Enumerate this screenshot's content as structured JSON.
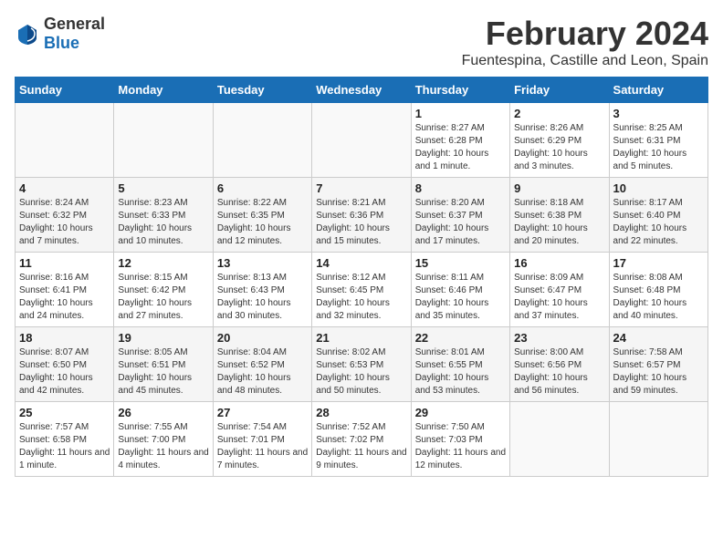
{
  "logo": {
    "general": "General",
    "blue": "Blue"
  },
  "title": "February 2024",
  "subtitle": "Fuentespina, Castille and Leon, Spain",
  "days_of_week": [
    "Sunday",
    "Monday",
    "Tuesday",
    "Wednesday",
    "Thursday",
    "Friday",
    "Saturday"
  ],
  "weeks": [
    [
      {
        "day": "",
        "detail": ""
      },
      {
        "day": "",
        "detail": ""
      },
      {
        "day": "",
        "detail": ""
      },
      {
        "day": "",
        "detail": ""
      },
      {
        "day": "1",
        "detail": "Sunrise: 8:27 AM\nSunset: 6:28 PM\nDaylight: 10 hours and 1 minute."
      },
      {
        "day": "2",
        "detail": "Sunrise: 8:26 AM\nSunset: 6:29 PM\nDaylight: 10 hours and 3 minutes."
      },
      {
        "day": "3",
        "detail": "Sunrise: 8:25 AM\nSunset: 6:31 PM\nDaylight: 10 hours and 5 minutes."
      }
    ],
    [
      {
        "day": "4",
        "detail": "Sunrise: 8:24 AM\nSunset: 6:32 PM\nDaylight: 10 hours and 7 minutes."
      },
      {
        "day": "5",
        "detail": "Sunrise: 8:23 AM\nSunset: 6:33 PM\nDaylight: 10 hours and 10 minutes."
      },
      {
        "day": "6",
        "detail": "Sunrise: 8:22 AM\nSunset: 6:35 PM\nDaylight: 10 hours and 12 minutes."
      },
      {
        "day": "7",
        "detail": "Sunrise: 8:21 AM\nSunset: 6:36 PM\nDaylight: 10 hours and 15 minutes."
      },
      {
        "day": "8",
        "detail": "Sunrise: 8:20 AM\nSunset: 6:37 PM\nDaylight: 10 hours and 17 minutes."
      },
      {
        "day": "9",
        "detail": "Sunrise: 8:18 AM\nSunset: 6:38 PM\nDaylight: 10 hours and 20 minutes."
      },
      {
        "day": "10",
        "detail": "Sunrise: 8:17 AM\nSunset: 6:40 PM\nDaylight: 10 hours and 22 minutes."
      }
    ],
    [
      {
        "day": "11",
        "detail": "Sunrise: 8:16 AM\nSunset: 6:41 PM\nDaylight: 10 hours and 24 minutes."
      },
      {
        "day": "12",
        "detail": "Sunrise: 8:15 AM\nSunset: 6:42 PM\nDaylight: 10 hours and 27 minutes."
      },
      {
        "day": "13",
        "detail": "Sunrise: 8:13 AM\nSunset: 6:43 PM\nDaylight: 10 hours and 30 minutes."
      },
      {
        "day": "14",
        "detail": "Sunrise: 8:12 AM\nSunset: 6:45 PM\nDaylight: 10 hours and 32 minutes."
      },
      {
        "day": "15",
        "detail": "Sunrise: 8:11 AM\nSunset: 6:46 PM\nDaylight: 10 hours and 35 minutes."
      },
      {
        "day": "16",
        "detail": "Sunrise: 8:09 AM\nSunset: 6:47 PM\nDaylight: 10 hours and 37 minutes."
      },
      {
        "day": "17",
        "detail": "Sunrise: 8:08 AM\nSunset: 6:48 PM\nDaylight: 10 hours and 40 minutes."
      }
    ],
    [
      {
        "day": "18",
        "detail": "Sunrise: 8:07 AM\nSunset: 6:50 PM\nDaylight: 10 hours and 42 minutes."
      },
      {
        "day": "19",
        "detail": "Sunrise: 8:05 AM\nSunset: 6:51 PM\nDaylight: 10 hours and 45 minutes."
      },
      {
        "day": "20",
        "detail": "Sunrise: 8:04 AM\nSunset: 6:52 PM\nDaylight: 10 hours and 48 minutes."
      },
      {
        "day": "21",
        "detail": "Sunrise: 8:02 AM\nSunset: 6:53 PM\nDaylight: 10 hours and 50 minutes."
      },
      {
        "day": "22",
        "detail": "Sunrise: 8:01 AM\nSunset: 6:55 PM\nDaylight: 10 hours and 53 minutes."
      },
      {
        "day": "23",
        "detail": "Sunrise: 8:00 AM\nSunset: 6:56 PM\nDaylight: 10 hours and 56 minutes."
      },
      {
        "day": "24",
        "detail": "Sunrise: 7:58 AM\nSunset: 6:57 PM\nDaylight: 10 hours and 59 minutes."
      }
    ],
    [
      {
        "day": "25",
        "detail": "Sunrise: 7:57 AM\nSunset: 6:58 PM\nDaylight: 11 hours and 1 minute."
      },
      {
        "day": "26",
        "detail": "Sunrise: 7:55 AM\nSunset: 7:00 PM\nDaylight: 11 hours and 4 minutes."
      },
      {
        "day": "27",
        "detail": "Sunrise: 7:54 AM\nSunset: 7:01 PM\nDaylight: 11 hours and 7 minutes."
      },
      {
        "day": "28",
        "detail": "Sunrise: 7:52 AM\nSunset: 7:02 PM\nDaylight: 11 hours and 9 minutes."
      },
      {
        "day": "29",
        "detail": "Sunrise: 7:50 AM\nSunset: 7:03 PM\nDaylight: 11 hours and 12 minutes."
      },
      {
        "day": "",
        "detail": ""
      },
      {
        "day": "",
        "detail": ""
      }
    ]
  ]
}
